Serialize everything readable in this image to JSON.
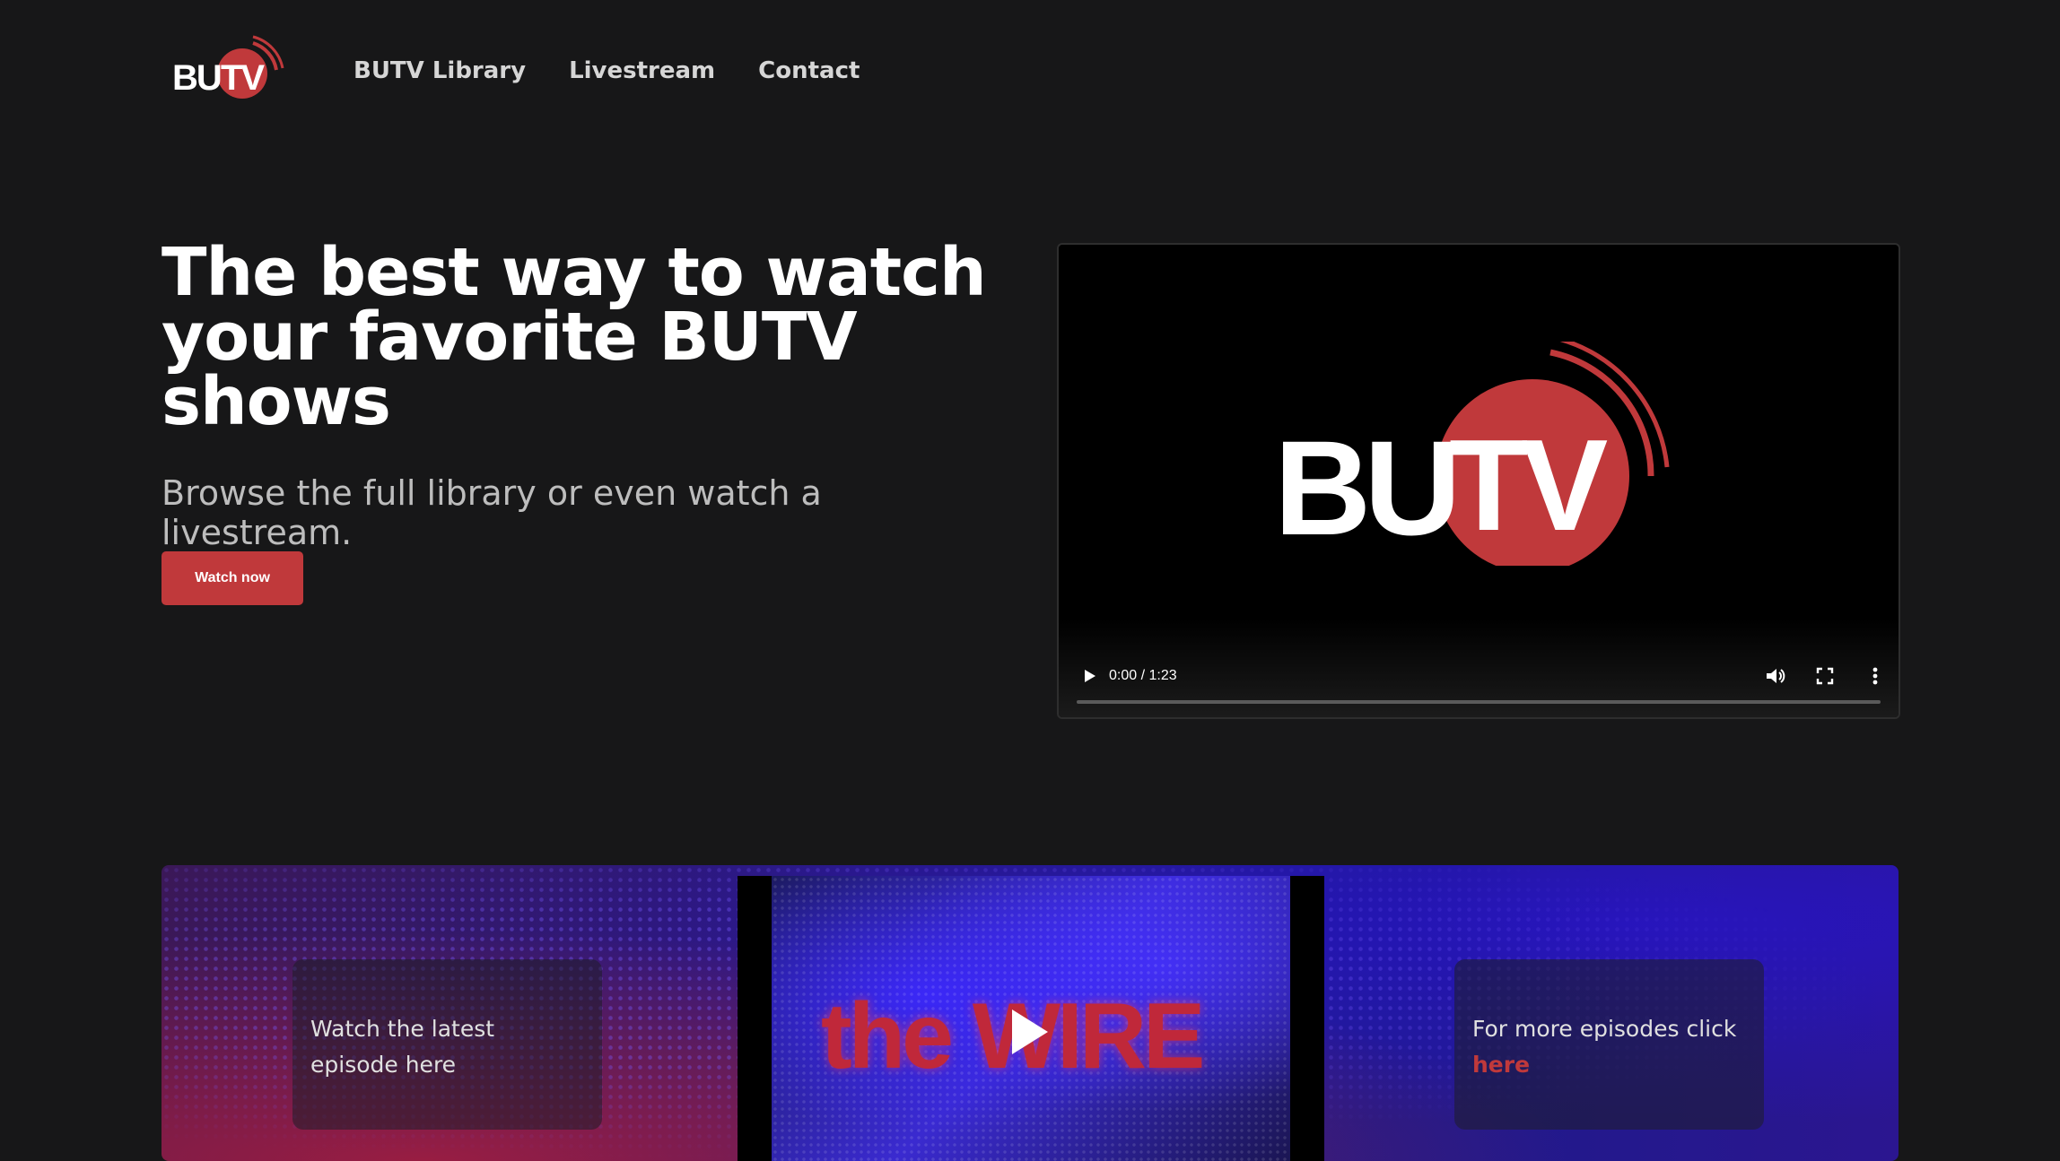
{
  "brand": {
    "logo_text": "BUTV",
    "accent": "#c0393b",
    "bg": "#171718"
  },
  "nav": {
    "links": [
      "BUTV Library",
      "Livestream",
      "Contact"
    ]
  },
  "hero": {
    "title": "The best way to watch your favorite BUTV shows",
    "subtitle": "Browse the full library or even watch a livestream.",
    "cta_label": "Watch now"
  },
  "player": {
    "time": "0:00 / 1:23",
    "icons": [
      "play-icon",
      "volume-icon",
      "fullscreen-icon",
      "more-options-icon"
    ]
  },
  "featured": {
    "left_card_text": "Watch the latest episode here",
    "right_card_prefix": "For more episodes click",
    "right_card_link": "here",
    "episode_title": "the WIRE"
  }
}
